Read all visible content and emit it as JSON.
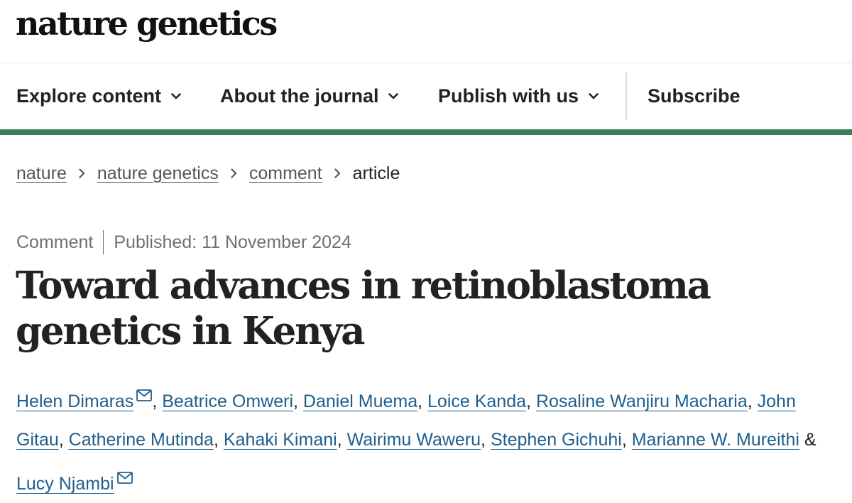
{
  "header": {
    "logo": "nature genetics"
  },
  "nav": {
    "items": [
      {
        "label": "Explore content",
        "icon": "chevron-down-icon"
      },
      {
        "label": "About the journal",
        "icon": "chevron-down-icon"
      },
      {
        "label": "Publish with us",
        "icon": "chevron-down-icon"
      }
    ],
    "subscribe": "Subscribe"
  },
  "colors": {
    "accent_bar": "#3b7e5b",
    "author_link": "#1f5e8d"
  },
  "breadcrumb": {
    "links": [
      "nature",
      "nature genetics",
      "comment"
    ],
    "current": "article",
    "separator_icon": "chevron-right-icon"
  },
  "article": {
    "type": "Comment",
    "published": "Published: 11 November 2024",
    "title": "Toward advances in retinoblastoma genetics in Kenya",
    "authors": [
      {
        "name": "Helen Dimaras",
        "email_icon": true
      },
      {
        "name": "Beatrice Omweri"
      },
      {
        "name": "Daniel Muema"
      },
      {
        "name": "Loice Kanda"
      },
      {
        "name": "Rosaline Wanjiru Macharia"
      },
      {
        "name": "John Gitau"
      },
      {
        "name": "Catherine Mutinda"
      },
      {
        "name": "Kahaki Kimani"
      },
      {
        "name": "Wairimu Waweru"
      },
      {
        "name": "Stephen Gichuhi"
      },
      {
        "name": "Marianne W. Mureithi"
      },
      {
        "name": "Lucy Njambi",
        "email_icon": true
      }
    ],
    "separator": ",",
    "final_separator": "&"
  }
}
